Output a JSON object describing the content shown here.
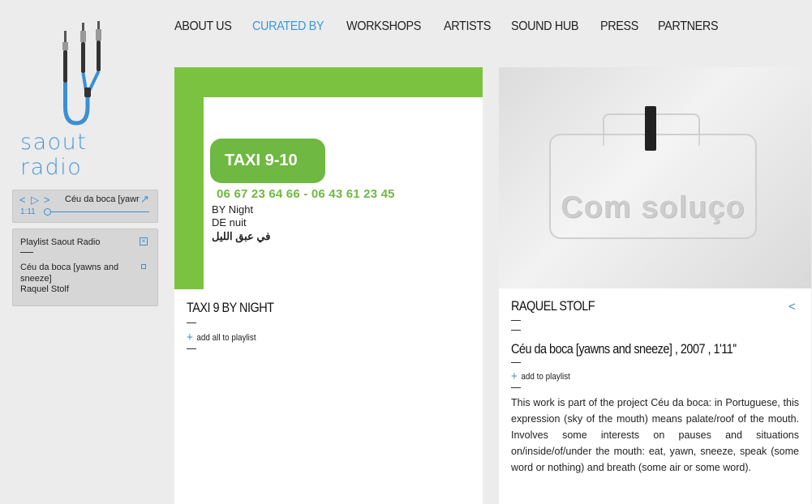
{
  "logo": {
    "text": "saout radio"
  },
  "nav": [
    {
      "label": "ABOUT US",
      "active": false
    },
    {
      "label": "CURATED BY",
      "active": true
    },
    {
      "label": "WORKSHOPS",
      "active": false
    },
    {
      "label": "ARTISTS",
      "active": false
    },
    {
      "label": "SOUND HUB",
      "active": false
    },
    {
      "label": "PRESS",
      "active": false
    },
    {
      "label": "PARTNERS",
      "active": false
    }
  ],
  "player": {
    "prev_icon": "<",
    "play_icon": "▷",
    "next_icon": ">",
    "now_playing": "Céu da boca [yawns and sneeze]",
    "expand_icon": "↗",
    "time": "1:11",
    "progress": 0.0
  },
  "playlist": {
    "title": "Playlist Saout Radio",
    "close_icon": "×",
    "items": [
      {
        "title": "Céu da boca [yawns and sneeze]",
        "artist": "Raquel Stolf"
      }
    ]
  },
  "card1": {
    "image": {
      "badge": "TAXI 9-10",
      "phone": "06 67 23 64 66 - 06 43 61 23 45",
      "line1": "BY Night",
      "line2": "DE nuit",
      "line3": "في عبق الليل"
    },
    "title": "TAXI 9 BY NIGHT",
    "add_all": "add all to playlist"
  },
  "card2": {
    "image": {
      "plaque_text": "Com soluço"
    },
    "title": "RAQUEL STOLF",
    "back_icon": "<",
    "work": "Céu da boca [yawns and sneeze] , 2007 , 1'11''",
    "add": "add to playlist",
    "description": "This work is part of the project Céu da boca: in Portuguese, this expression (sky of the mouth) means palate/roof of the mouth. Involves some interests on pauses and situations on/inside/of/under the mouth: eat, yawn, sneeze, speak (some word or nothing) and breath (some air or some word)."
  },
  "colors": {
    "accent": "#3a9ad9",
    "green": "#7cc241",
    "panel": "#d6d6d6"
  }
}
